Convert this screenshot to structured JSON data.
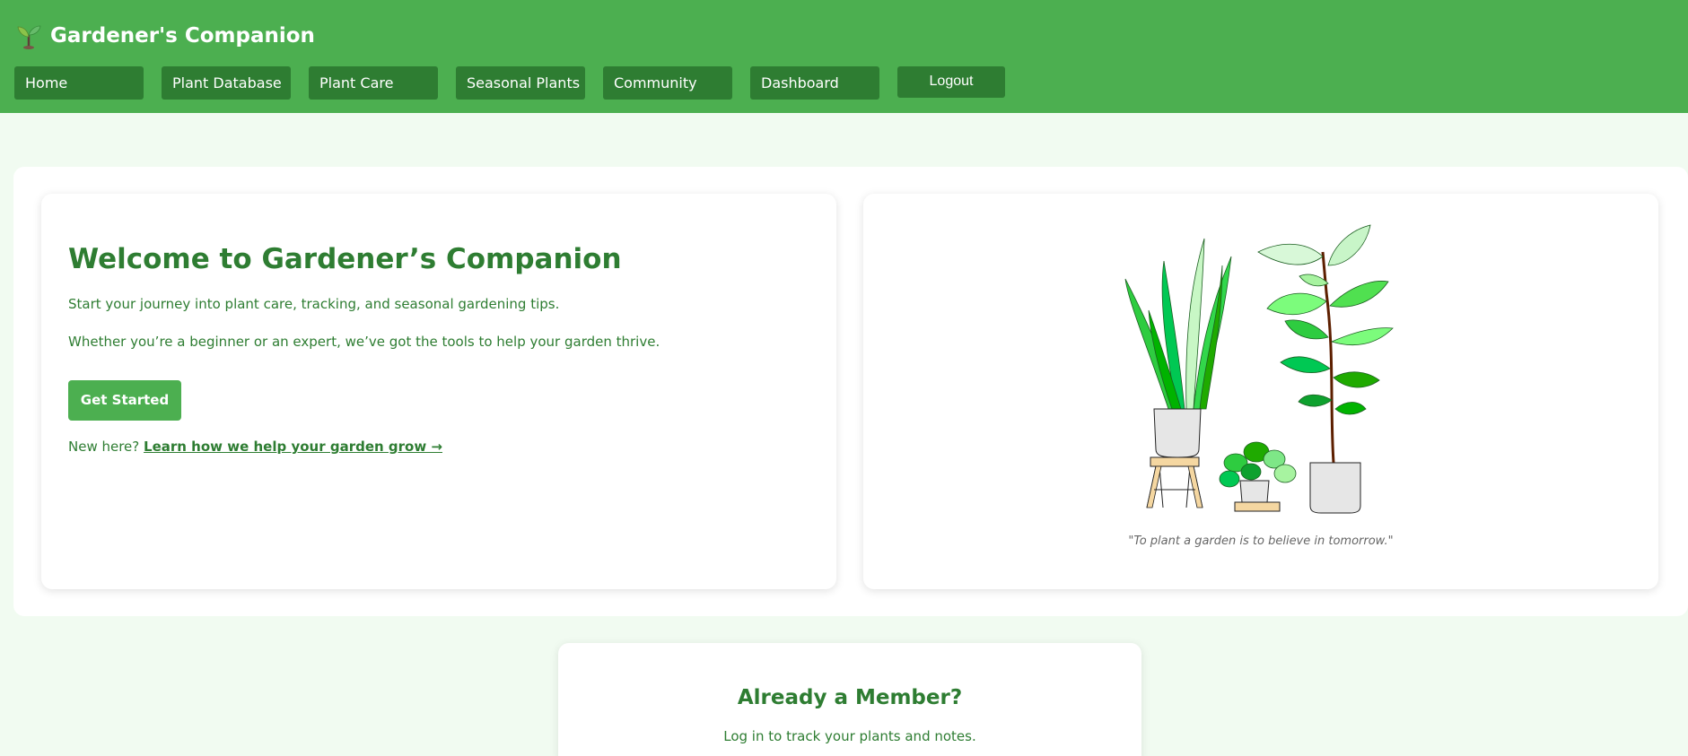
{
  "header": {
    "brand_icon": "seedling-icon",
    "title": "Gardener's Companion",
    "background": "#4caf50",
    "nav_color": "#2e7d32"
  },
  "nav": {
    "items": [
      {
        "label": "Home"
      },
      {
        "label": "Plant Database"
      },
      {
        "label": "Plant Care"
      },
      {
        "label": "Seasonal Plants"
      },
      {
        "label": "Community"
      },
      {
        "label": "Dashboard"
      }
    ],
    "logout_label": "Logout"
  },
  "hero": {
    "title": "Welcome to Gardener’s Companion",
    "intro_1": "Start your journey into plant care, tracking, and seasonal gardening tips.",
    "intro_2": "Whether you’re a beginner or an expert, we’ve got the tools to help your garden thrive.",
    "cta_label": "Get Started",
    "new_here_prefix": "New here?",
    "learn_link": "Learn how we help your garden grow →",
    "quote": "\"To plant a garden is to believe in tomorrow.\"",
    "illustration_icon": "potted-plants-illustration"
  },
  "member": {
    "title": "Already a Member?",
    "subtitle": "Log in to track your plants and notes."
  }
}
